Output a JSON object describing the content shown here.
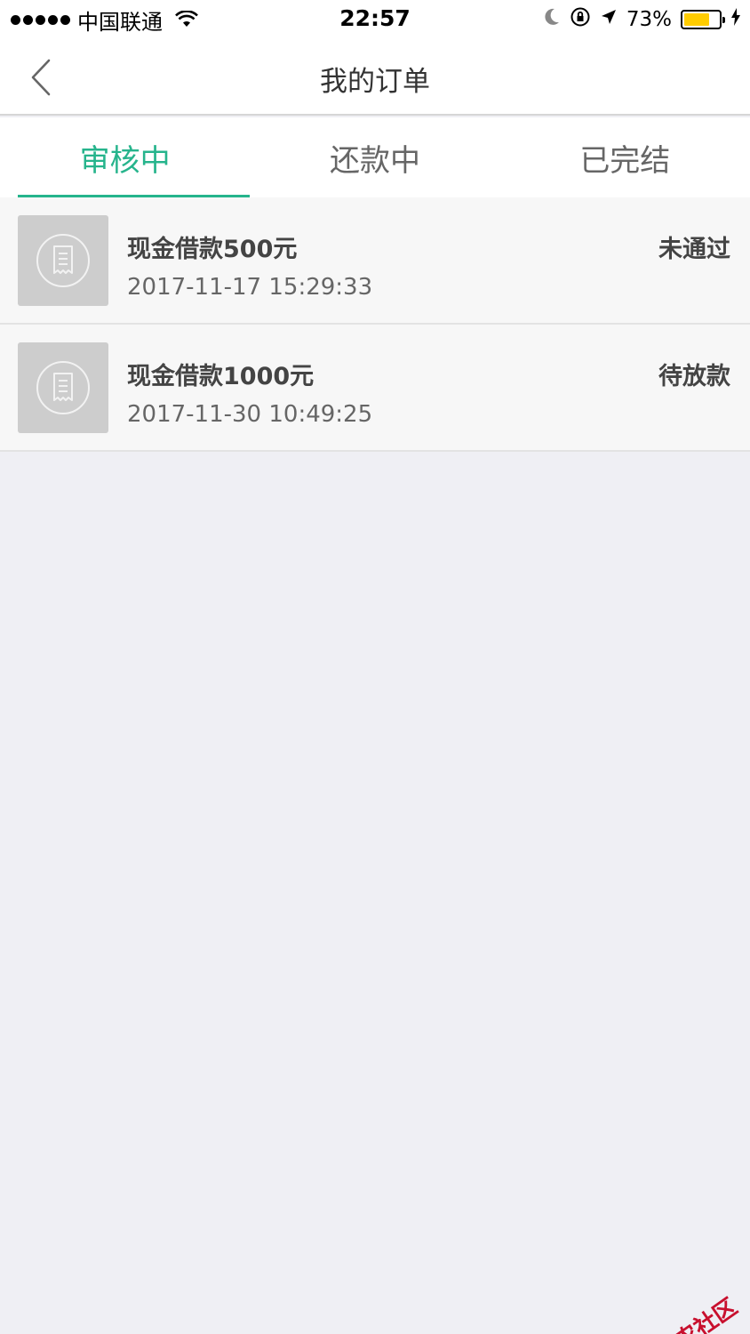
{
  "status_bar": {
    "carrier": "中国联通",
    "time": "22:57",
    "battery_percent": "73%",
    "battery_level": 0.73,
    "battery_color": "#ffcc00"
  },
  "nav": {
    "title": "我的订单"
  },
  "tabs": [
    {
      "label": "审核中",
      "active": true
    },
    {
      "label": "还款中",
      "active": false
    },
    {
      "label": "已完结",
      "active": false
    }
  ],
  "accent_color": "#26b48c",
  "orders": [
    {
      "title": "现金借款500元",
      "time": "2017-11-17 15:29:33",
      "status": "未通过"
    },
    {
      "title": "现金借款1000元",
      "time": "2017-11-30 10:49:25",
      "status": "待放款"
    }
  ],
  "watermark": {
    "text": "卡农社区"
  }
}
